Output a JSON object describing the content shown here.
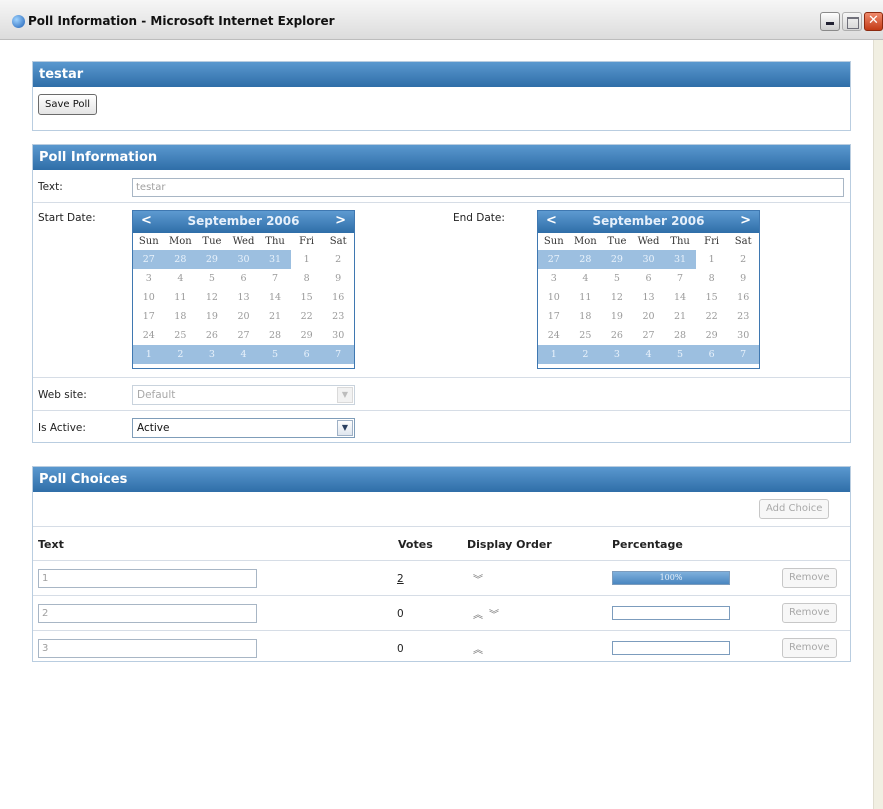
{
  "window": {
    "title": "Poll Information - Microsoft Internet Explorer"
  },
  "poll_panel": {
    "title": "testar",
    "save_label": "Save Poll"
  },
  "info_panel": {
    "title": "Poll Information",
    "text_label": "Text:",
    "text_value": "testar",
    "start_label": "Start Date:",
    "end_label": "End Date:",
    "website_label": "Web site:",
    "website_value": "Default",
    "active_label": "Is Active:",
    "active_value": "Active"
  },
  "calendar": {
    "prev": "<",
    "next": ">",
    "month": "September 2006",
    "weekdays": [
      "Sun",
      "Mon",
      "Tue",
      "Wed",
      "Thu",
      "Fri",
      "Sat"
    ],
    "days": [
      [
        "27",
        "28",
        "29",
        "30",
        "31",
        "1",
        "2"
      ],
      [
        "3",
        "4",
        "5",
        "6",
        "7",
        "8",
        "9"
      ],
      [
        "10",
        "11",
        "12",
        "13",
        "14",
        "15",
        "16"
      ],
      [
        "17",
        "18",
        "19",
        "20",
        "21",
        "22",
        "23"
      ],
      [
        "24",
        "25",
        "26",
        "27",
        "28",
        "29",
        "30"
      ],
      [
        "1",
        "2",
        "3",
        "4",
        "5",
        "6",
        "7"
      ]
    ]
  },
  "choices_panel": {
    "title": "Poll Choices",
    "add_label": "Add Choice",
    "headers": {
      "text": "Text",
      "votes": "Votes",
      "order": "Display Order",
      "percentage": "Percentage"
    },
    "remove_label": "Remove",
    "rows": [
      {
        "text": "1",
        "votes": "2",
        "order_up": "",
        "order_down": "︾",
        "percent_value": 100,
        "percent_label": "100%"
      },
      {
        "text": "2",
        "votes": "0",
        "order_up": "︽",
        "order_down": "︾",
        "percent_value": 0,
        "percent_label": ""
      },
      {
        "text": "3",
        "votes": "0",
        "order_up": "︽",
        "order_down": "",
        "percent_value": 0,
        "percent_label": ""
      }
    ]
  }
}
